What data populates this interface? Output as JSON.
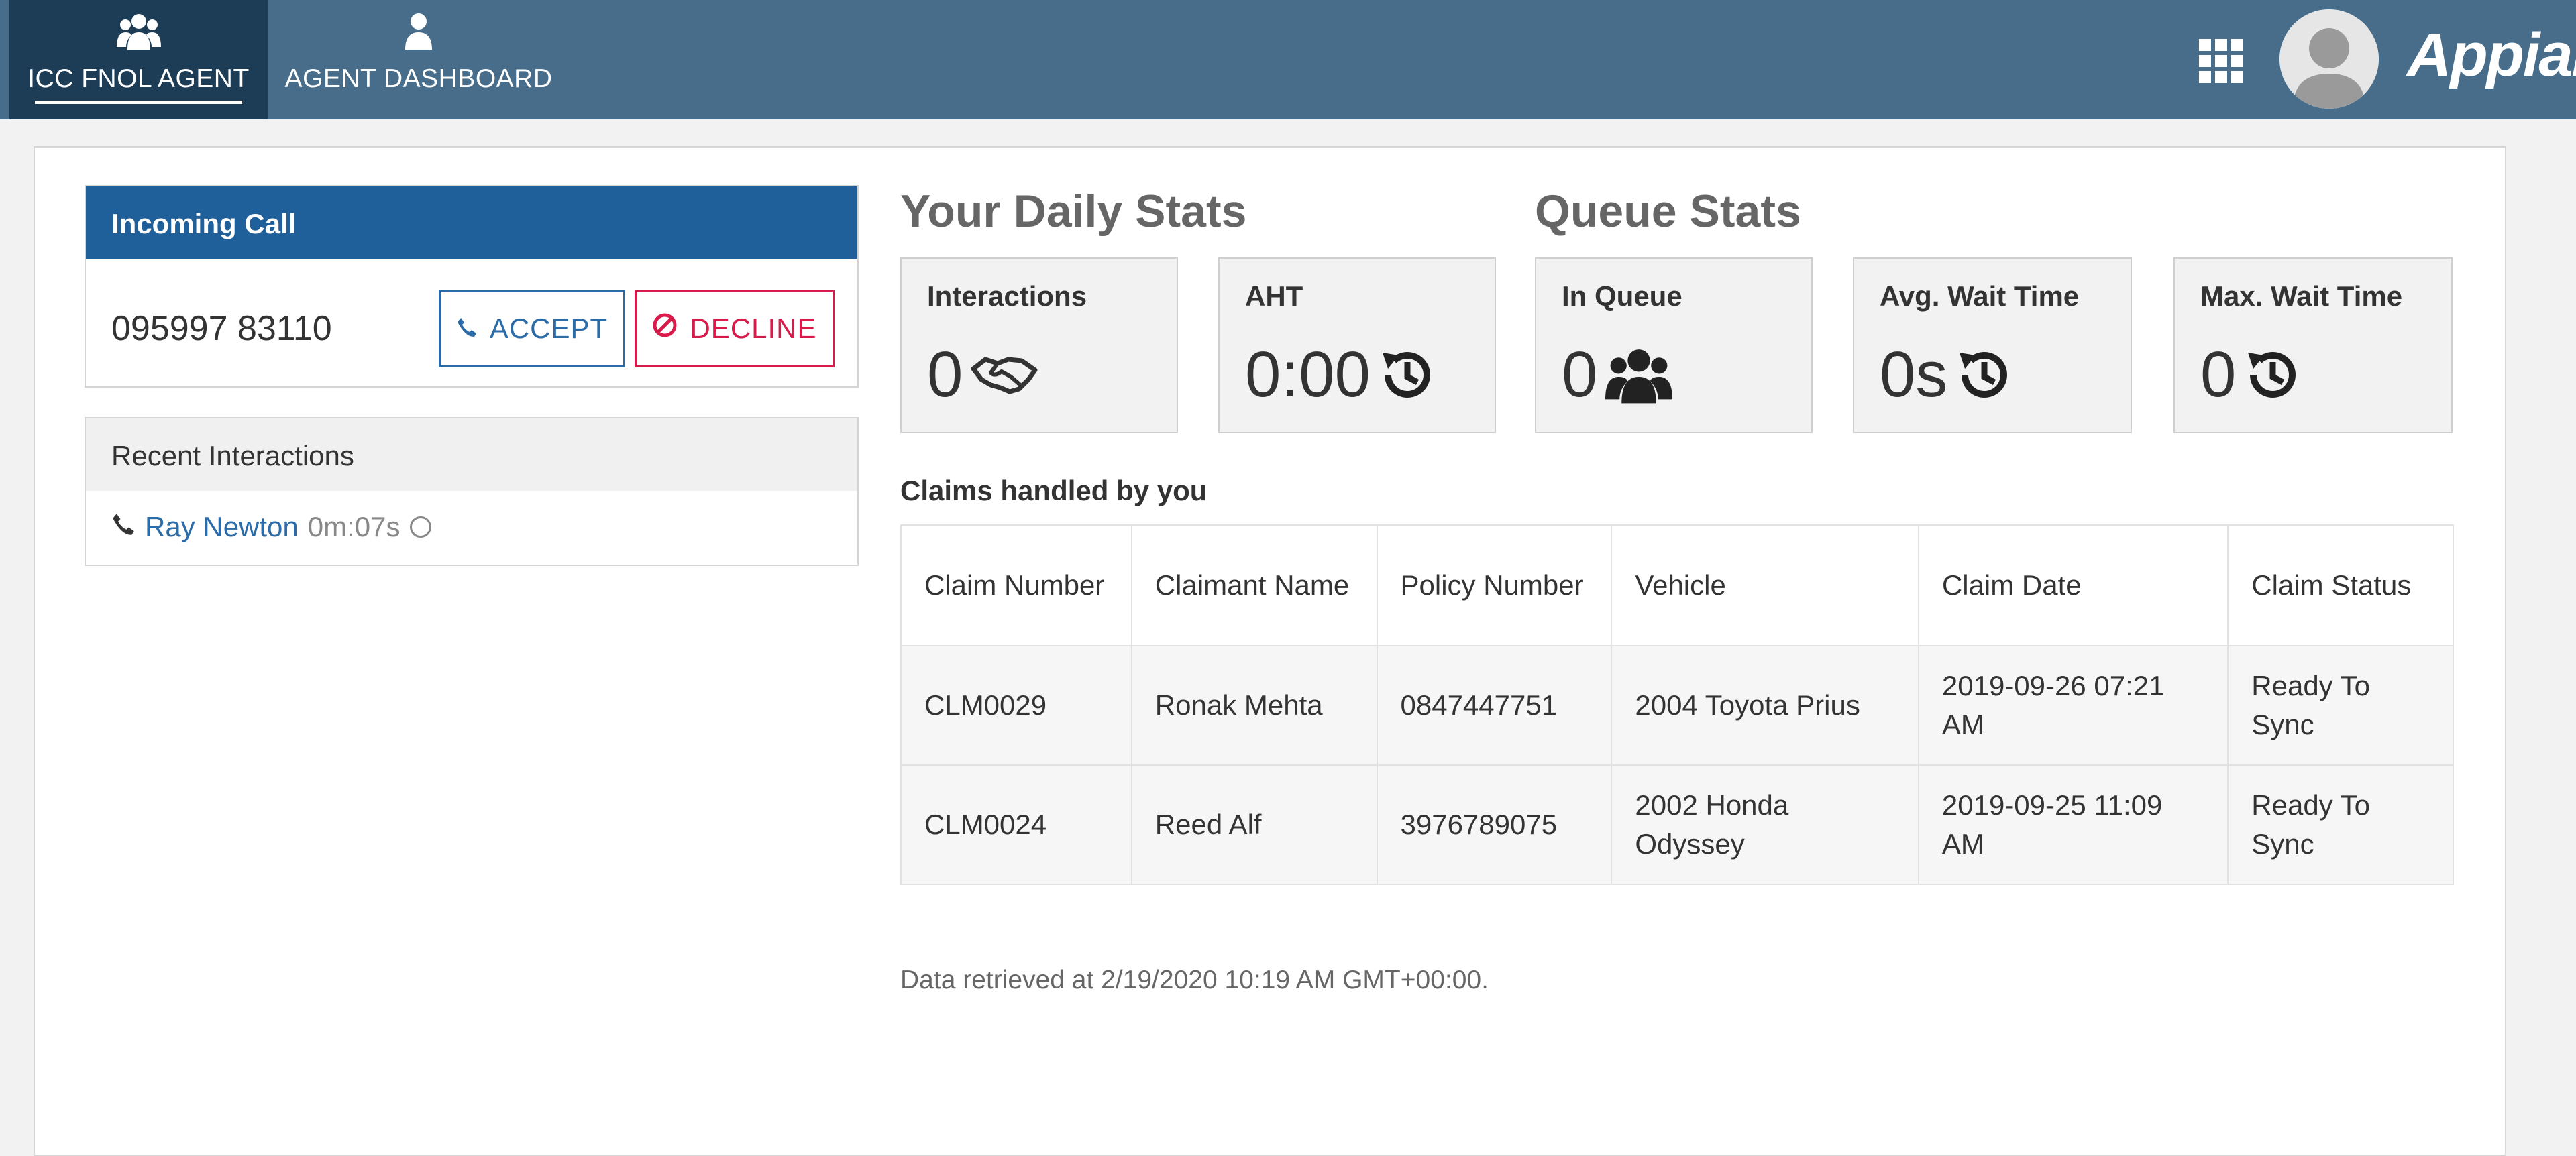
{
  "nav": {
    "tabs": [
      {
        "label": "ICC FNOL AGENT",
        "icon": "users-icon",
        "active": true
      },
      {
        "label": "AGENT DASHBOARD",
        "icon": "user-icon",
        "active": false
      }
    ],
    "brand": "Appian",
    "apps_icon": "grid-icon",
    "avatar_icon": "avatar"
  },
  "incoming": {
    "title": "Incoming Call",
    "phone_number": "095997 83110",
    "accept_label": "ACCEPT",
    "decline_label": "DECLINE"
  },
  "recent": {
    "title": "Recent Interactions",
    "items": [
      {
        "name": "Ray Newton",
        "duration": "0m:07s"
      }
    ]
  },
  "daily_stats": {
    "title": "Your Daily Stats",
    "interactions": {
      "label": "Interactions",
      "value": "0",
      "icon": "handshake-icon"
    },
    "aht": {
      "label": "AHT",
      "value": "0:00",
      "icon": "history-icon"
    }
  },
  "queue_stats": {
    "title": "Queue Stats",
    "in_queue": {
      "label": "In Queue",
      "value": "0",
      "icon": "users-icon"
    },
    "avg_wait": {
      "label": "Avg. Wait Time",
      "value": "0s",
      "icon": "history-icon"
    },
    "max_wait": {
      "label": "Max. Wait Time",
      "value": "0",
      "icon": "history-icon"
    }
  },
  "claims": {
    "title": "Claims handled by you",
    "headers": [
      "Claim Number",
      "Claimant Name",
      "Policy Number",
      "Vehicle",
      "Claim Date",
      "Claim Status"
    ],
    "rows": [
      [
        "CLM0029",
        "Ronak Mehta",
        "0847447751",
        "2004 Toyota Prius",
        "2019-09-26 07:21 AM",
        "Ready To Sync"
      ],
      [
        "CLM0024",
        "Reed Alf",
        "3976789075",
        "2002 Honda Odyssey",
        "2019-09-25 11:09 AM",
        "Ready To Sync"
      ]
    ]
  },
  "footer": {
    "retrieved": "Data retrieved at 2/19/2020 10:19 AM GMT+00:00."
  },
  "colors": {
    "topbar": "#476d8a",
    "active_tab": "#1d3c56",
    "incoming_header": "#1f5f9a",
    "accept": "#2a6ba8",
    "decline": "#d81b4a"
  }
}
